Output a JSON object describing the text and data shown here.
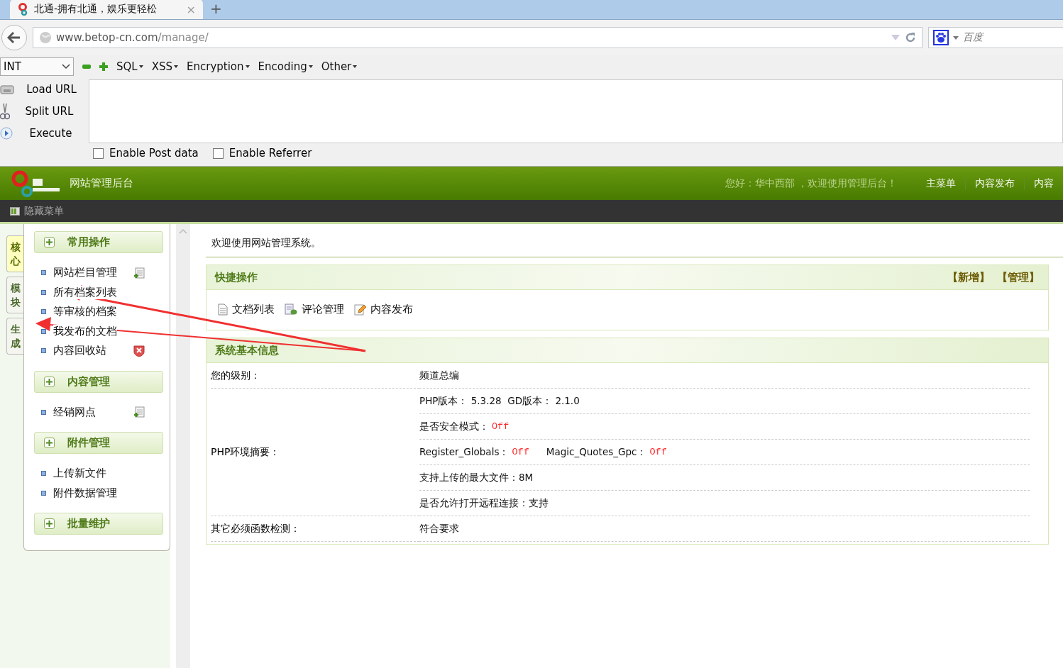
{
  "browser": {
    "tab": {
      "title": "北通-拥有北通，娱乐更轻松",
      "close": "×"
    },
    "new_tab": "+",
    "url": {
      "host": "www.betop-cn.com",
      "path": "/manage/"
    },
    "search": {
      "placeholder": "百度"
    }
  },
  "hackbar": {
    "select": "INT",
    "menus": [
      "SQL",
      "XSS",
      "Encryption",
      "Encoding",
      "Other"
    ],
    "actions": [
      {
        "label": "Load URL",
        "kind": "load"
      },
      {
        "label": "Split URL",
        "kind": "split"
      },
      {
        "label": "Execute",
        "kind": "execute"
      }
    ],
    "options": [
      {
        "label": "Enable Post data",
        "checked": false
      },
      {
        "label": "Enable Referrer",
        "checked": false
      }
    ]
  },
  "header": {
    "title": "网站管理后台",
    "greeting": "您好：华中西部 ，欢迎使用管理后台！",
    "nav": [
      "主菜单",
      "内容发布",
      "内容"
    ]
  },
  "toolbar": {
    "toggle": "隐藏菜单"
  },
  "side_tabs": [
    {
      "label": "核心",
      "selected": true
    },
    {
      "label": "模块",
      "selected": false
    },
    {
      "label": "生成",
      "selected": false
    }
  ],
  "menu": [
    {
      "title": "常用操作",
      "items": [
        {
          "label": "网站栏目管理",
          "kind": "add"
        },
        {
          "label": "所有档案列表",
          "kind": "plain"
        },
        {
          "label": "等审核的档案",
          "kind": "plain"
        },
        {
          "label": "我发布的文档",
          "kind": "plain"
        },
        {
          "label": "内容回收站",
          "kind": "trash"
        }
      ]
    },
    {
      "title": "内容管理",
      "items": [
        {
          "label": "经销网点",
          "kind": "add"
        }
      ]
    },
    {
      "title": "附件管理",
      "items": [
        {
          "label": "上传新文件",
          "kind": "plain"
        },
        {
          "label": "附件数据管理",
          "kind": "plain"
        }
      ]
    },
    {
      "title": "批量维护"
    }
  ],
  "welcome": "欢迎使用网站管理系统。",
  "quick": {
    "title": "快捷操作",
    "links": [
      "【新增】",
      "【管理】"
    ],
    "items": [
      {
        "label": "文档列表",
        "kind": "doc"
      },
      {
        "label": "评论管理",
        "kind": "comment"
      },
      {
        "label": "内容发布",
        "kind": "edit"
      }
    ]
  },
  "info": {
    "title": "系统基本信息",
    "rows": [
      {
        "label": "您的级别：",
        "values": [
          [
            {
              "text": "频道总编",
              "kind": "text"
            }
          ]
        ]
      },
      {
        "label": "PHP环境摘要：",
        "values": [
          [
            {
              "text": "PHP版本： 5.3.28  GD版本： 2.1.0",
              "kind": "text"
            }
          ],
          [
            {
              "text": "是否安全模式：",
              "kind": "text"
            },
            {
              "text": "Off",
              "kind": "off"
            }
          ],
          [
            {
              "text": "Register_Globals：",
              "kind": "text"
            },
            {
              "text": "Off",
              "kind": "off"
            },
            {
              "text": "Magic_Quotes_Gpc：",
              "kind": "text"
            },
            {
              "text": "Off",
              "kind": "off"
            }
          ],
          [
            {
              "text": "支持上传的最大文件：8M",
              "kind": "text"
            }
          ],
          [
            {
              "text": "是否允许打开远程连接：支持",
              "kind": "text"
            }
          ]
        ]
      },
      {
        "label": "其它必须函数检测：",
        "values": [
          [
            {
              "text": "符合要求",
              "kind": "text"
            }
          ]
        ]
      }
    ]
  }
}
